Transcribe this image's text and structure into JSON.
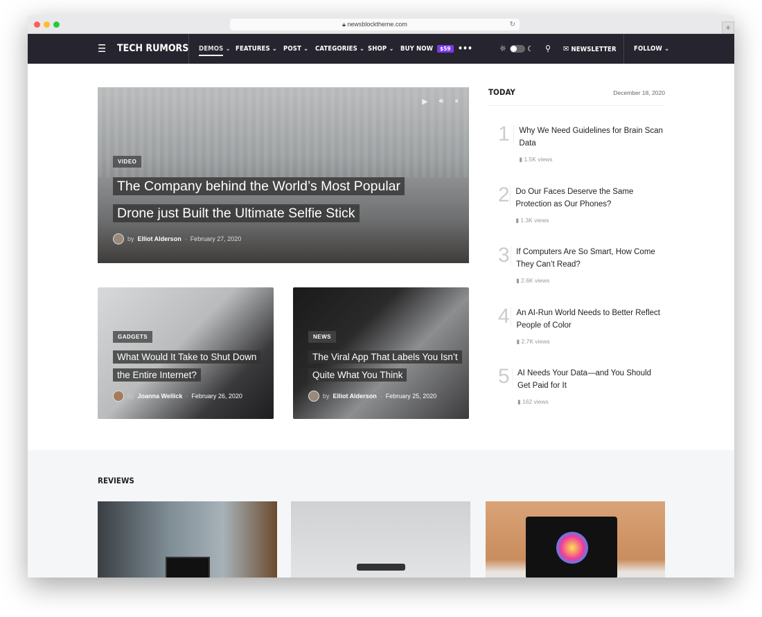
{
  "browser": {
    "url": "newsblocktheme.com"
  },
  "nav": {
    "logo": "TECH RUMORS",
    "items": [
      "DEMOS",
      "FEATURES",
      "POST",
      "CATEGORIES",
      "SHOP"
    ],
    "buy_now": "BUY NOW",
    "price_badge": "$59",
    "newsletter": "NEWSLETTER",
    "follow": "FOLLOW",
    "accent": "#7b39ed"
  },
  "hero": {
    "tag": "VIDEO",
    "title_lines": [
      "The Company behind the World’s Most Popular",
      "Drone just Built the Ultimate Selfie Stick"
    ],
    "by": "by",
    "author": "Elliot Alderson",
    "date": "February 27, 2020"
  },
  "cards": [
    {
      "tag": "GADGETS",
      "title_lines": [
        "What Would It Take to Shut Down",
        "the Entire Internet?"
      ],
      "by": "by",
      "author": "Joanna Wellick",
      "date": "February 26, 2020"
    },
    {
      "tag": "NEWS",
      "title_lines": [
        "The Viral App That Labels You Isn’t",
        "Quite What You Think"
      ],
      "by": "by",
      "author": "Elliot Alderson",
      "date": "February 25, 2020"
    }
  ],
  "today": {
    "heading": "TODAY",
    "date": "December 18, 2020",
    "items": [
      {
        "num": "1",
        "title": "Why We Need Guidelines for Brain Scan Data",
        "views": "1.5K views"
      },
      {
        "num": "2",
        "title": "Do Our Faces Deserve the Same Protection as Our Phones?",
        "views": "1.3K views"
      },
      {
        "num": "3",
        "title": "If Computers Are So Smart, How Come They Can’t Read?",
        "views": "2.6K views"
      },
      {
        "num": "4",
        "title": "An AI-Run World Needs to Better Reflect People of Color",
        "views": "2.7K views"
      },
      {
        "num": "5",
        "title": "AI Needs Your Data—and You Should Get Paid for It",
        "views": "162 views"
      }
    ]
  },
  "reviews": {
    "heading": "REVIEWS"
  }
}
